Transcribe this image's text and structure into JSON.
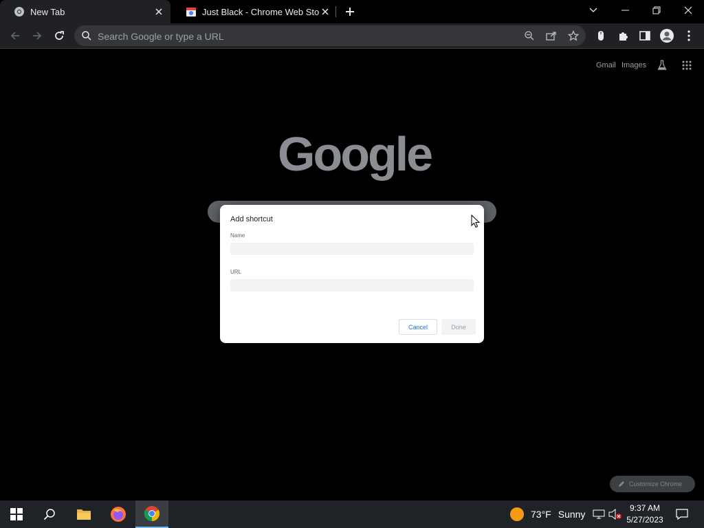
{
  "browser": {
    "tabs": [
      {
        "title": "New Tab",
        "active": true
      },
      {
        "title": "Just Black - Chrome Web Store",
        "active": false
      }
    ],
    "omnibox": {
      "placeholder": "Search Google or type a URL"
    }
  },
  "ntp": {
    "links": {
      "gmail": "Gmail",
      "images": "Images"
    },
    "logo": "Google",
    "customize_label": "Customize Chrome"
  },
  "dialog": {
    "title": "Add shortcut",
    "name_label": "Name",
    "name_value": "",
    "url_label": "URL",
    "url_value": "",
    "cancel_label": "Cancel",
    "done_label": "Done"
  },
  "taskbar": {
    "weather": {
      "temp": "73°F",
      "condition": "Sunny"
    },
    "clock": {
      "time": "9:37 AM",
      "date": "5/27/2023"
    }
  },
  "colors": {
    "background": "#000000",
    "toolbar": "#202124",
    "accent": "#1a73e8",
    "taskbar": "#1f2226"
  }
}
